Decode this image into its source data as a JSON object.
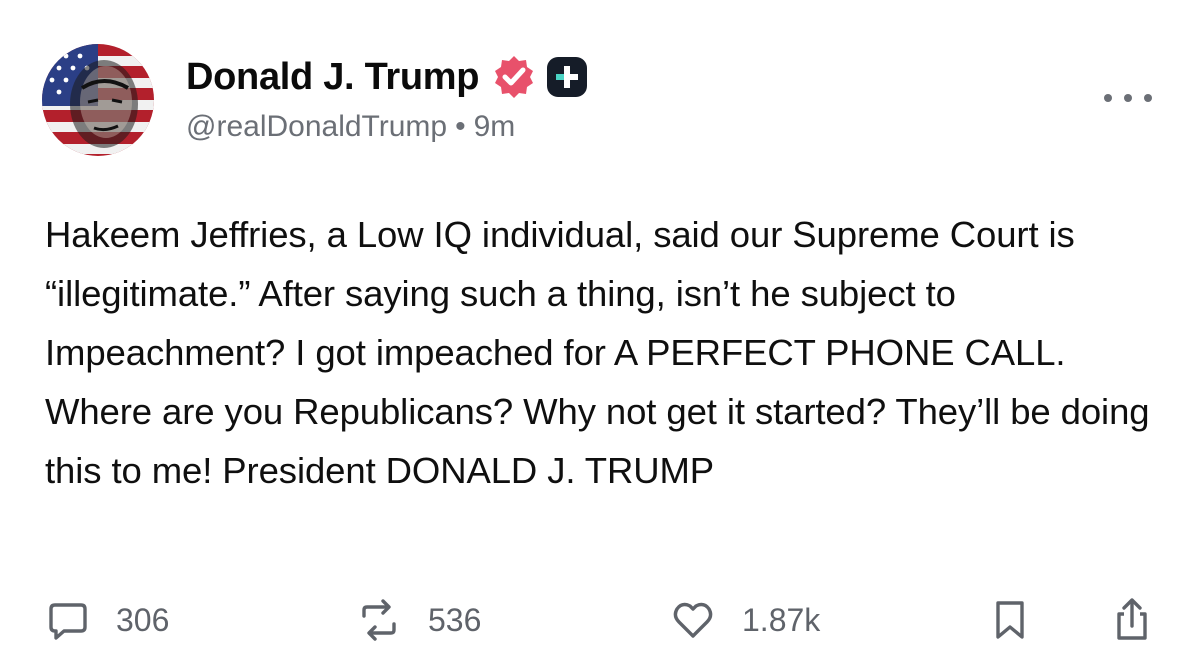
{
  "author": {
    "display_name": "Donald J. Trump",
    "handle": "@realDonaldTrump",
    "separator": "•",
    "time_ago": "9m",
    "verified_color": "#e8516b",
    "plus_badge_color": "#151c28",
    "plus_accent_color": "#4ad3c4"
  },
  "post": {
    "text": "Hakeem Jeffries, a Low IQ individual, said our Supreme Court is “illegitimate.” After saying such a thing, isn’t he subject to Impeachment? I got impeached for A PERFECT PHONE CALL. Where are you Republicans? Why not get it started? They’ll be doing this to me! President DONALD J. TRUMP"
  },
  "actions": {
    "reply_count": "306",
    "repost_count": "536",
    "like_count": "1.87k"
  },
  "icons": {
    "reply": "comment-bubble-icon",
    "repost": "repost-arrows-icon",
    "like": "heart-icon",
    "bookmark": "bookmark-icon",
    "share": "share-icon",
    "more": "more-dots-icon",
    "verified": "verified-badge-icon",
    "plus": "plus-badge-icon"
  }
}
